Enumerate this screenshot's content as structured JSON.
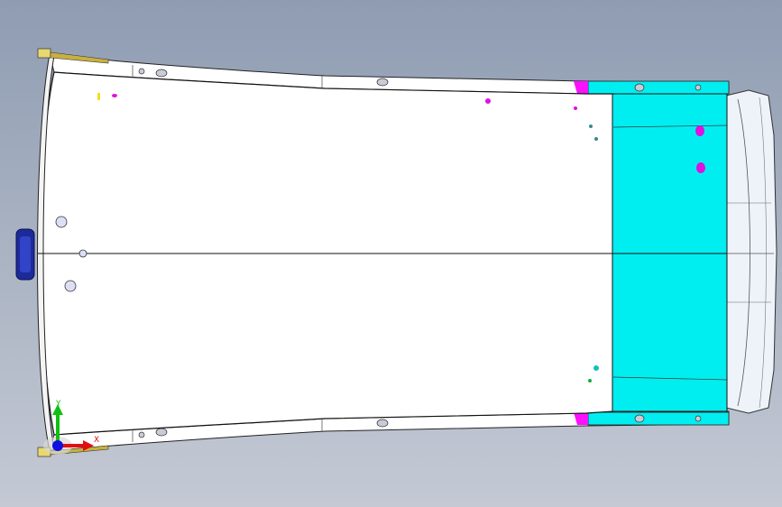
{
  "viewport": {
    "background_top": "#8f9cb2",
    "background_bottom": "#c4c9d4"
  },
  "model": {
    "panel_color": "#ffffff",
    "edge_color": "#1a1a1a",
    "accent_color": "#00f0f0",
    "highlight_color": "#ff00ff",
    "emblem_color": "#1c2a9a"
  },
  "triad": {
    "x_label": "X",
    "y_label": "Y",
    "x_color": "#e01010",
    "y_color": "#10c010",
    "z_color": "#1010e0"
  }
}
